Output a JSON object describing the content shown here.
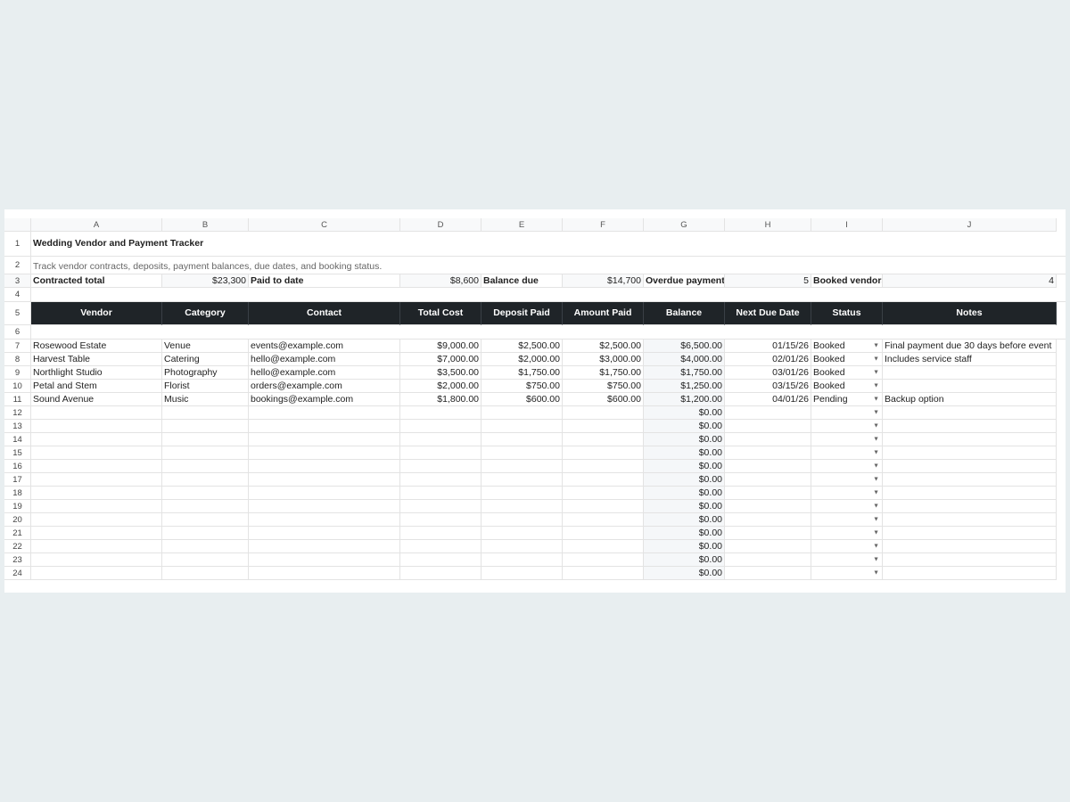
{
  "columns": [
    "A",
    "B",
    "C",
    "D",
    "E",
    "F",
    "G",
    "H",
    "I",
    "J"
  ],
  "title": "Wedding Vendor and Payment Tracker",
  "subtitle": "Track vendor contracts, deposits, payment balances, due dates, and booking status.",
  "summary": {
    "contracted_label": "Contracted total",
    "contracted_value": "$23,300",
    "paid_label": "Paid to date",
    "paid_value": "$8,600",
    "balance_label": "Balance due",
    "balance_value": "$14,700",
    "overdue_label": "Overdue payments",
    "overdue_value": "5",
    "booked_label": "Booked vendors",
    "booked_value": "4"
  },
  "headers": [
    "Vendor",
    "Category",
    "Contact",
    "Total Cost",
    "Deposit Paid",
    "Amount Paid",
    "Balance",
    "Next Due Date",
    "Status",
    "Notes"
  ],
  "rows": [
    {
      "vendor": "Rosewood Estate",
      "category": "Venue",
      "contact": "events@example.com",
      "total": "$9,000.00",
      "deposit": "$2,500.00",
      "paid": "$2,500.00",
      "balance": "$6,500.00",
      "due": "01/15/26",
      "status": "Booked",
      "notes": "Final payment due 30 days before event"
    },
    {
      "vendor": "Harvest Table",
      "category": "Catering",
      "contact": "hello@example.com",
      "total": "$7,000.00",
      "deposit": "$2,000.00",
      "paid": "$3,000.00",
      "balance": "$4,000.00",
      "due": "02/01/26",
      "status": "Booked",
      "notes": "Includes service staff"
    },
    {
      "vendor": "Northlight Studio",
      "category": "Photography",
      "contact": "hello@example.com",
      "total": "$3,500.00",
      "deposit": "$1,750.00",
      "paid": "$1,750.00",
      "balance": "$1,750.00",
      "due": "03/01/26",
      "status": "Booked",
      "notes": ""
    },
    {
      "vendor": "Petal and Stem",
      "category": "Florist",
      "contact": "orders@example.com",
      "total": "$2,000.00",
      "deposit": "$750.00",
      "paid": "$750.00",
      "balance": "$1,250.00",
      "due": "03/15/26",
      "status": "Booked",
      "notes": ""
    },
    {
      "vendor": "Sound Avenue",
      "category": "Music",
      "contact": "bookings@example.com",
      "total": "$1,800.00",
      "deposit": "$600.00",
      "paid": "$600.00",
      "balance": "$1,200.00",
      "due": "04/01/26",
      "status": "Pending",
      "notes": "Backup option"
    }
  ],
  "empty_balance": "$0.00",
  "row_numbers": [
    "1",
    "2",
    "3",
    "4",
    "5",
    "6",
    "7",
    "8",
    "9",
    "10",
    "11",
    "12",
    "13",
    "14",
    "15",
    "16",
    "17",
    "18",
    "19",
    "20",
    "21",
    "22",
    "23",
    "24"
  ],
  "dropdown_icon": "triangle-down-icon",
  "colors": {
    "header_bg": "#1f2428",
    "background": "#e8eef0"
  }
}
